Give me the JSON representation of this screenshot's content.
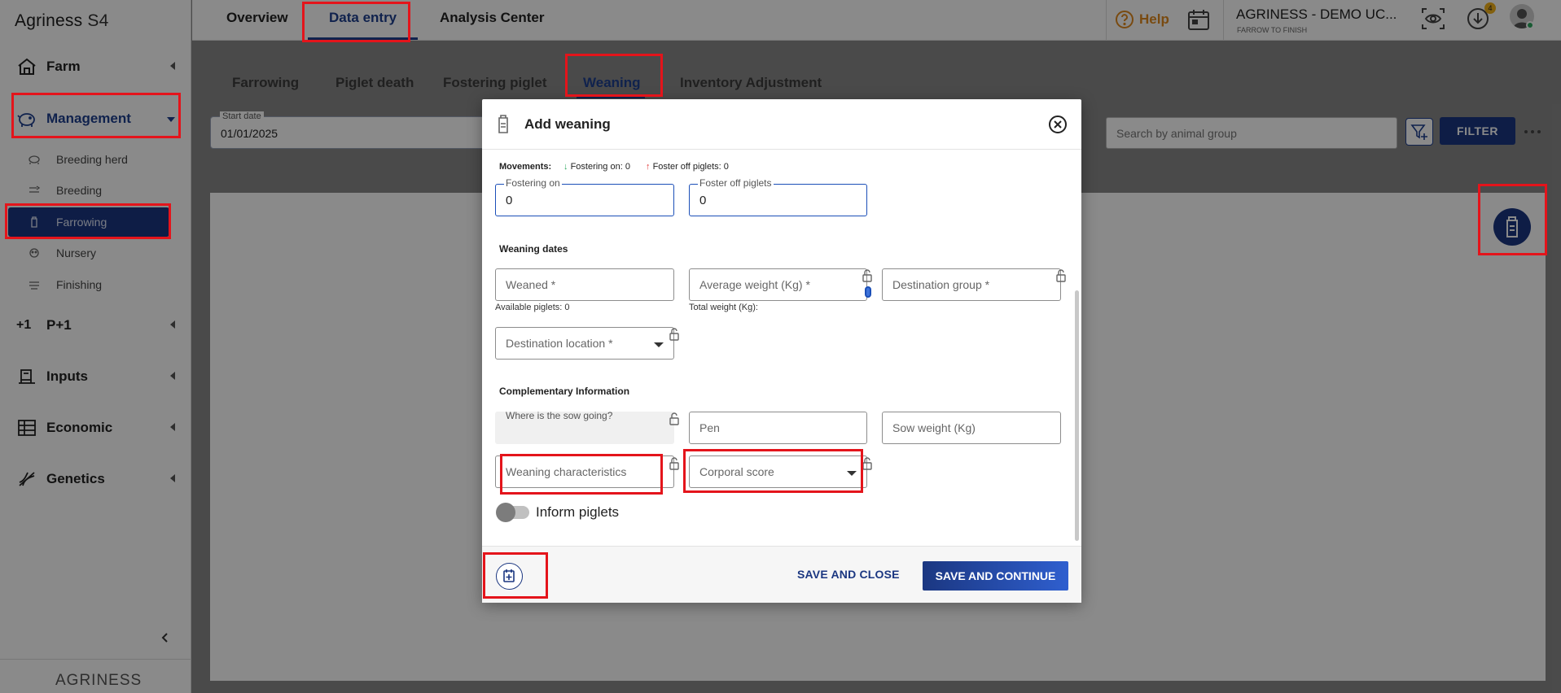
{
  "app": {
    "name": "Agriness",
    "version": "S4",
    "logo": "AGRINESS"
  },
  "sidebar": {
    "items": [
      {
        "label": "Farm",
        "icon": "farm-icon"
      },
      {
        "label": "Management",
        "icon": "management-icon",
        "expanded": true
      },
      {
        "label": "P+1",
        "icon": "p1-icon"
      },
      {
        "label": "Inputs",
        "icon": "inputs-icon"
      },
      {
        "label": "Economic",
        "icon": "economic-icon"
      },
      {
        "label": "Genetics",
        "icon": "genetics-icon"
      }
    ],
    "sub_items": [
      {
        "label": "Breeding herd",
        "icon": "breeding-herd-icon"
      },
      {
        "label": "Breeding",
        "icon": "breeding-icon"
      },
      {
        "label": "Farrowing",
        "icon": "farrowing-icon",
        "active": true
      },
      {
        "label": "Nursery",
        "icon": "nursery-icon"
      },
      {
        "label": "Finishing",
        "icon": "finishing-icon"
      }
    ]
  },
  "topbar": {
    "tabs": [
      "Overview",
      "Data entry",
      "Analysis Center"
    ],
    "active_tab": "Data entry",
    "help_label": "Help",
    "org_name": "AGRINESS - DEMO UC...",
    "org_subtitle": "FARROW TO FINISH",
    "download_badge": "4"
  },
  "subtabs": {
    "items": [
      "Farrowing",
      "Piglet death",
      "Fostering piglet",
      "Weaning",
      "Inventory Adjustment"
    ],
    "active": "Weaning"
  },
  "filters": {
    "start_date_label": "Start date",
    "start_date_value": "01/01/2025",
    "search_placeholder": "Search by animal group",
    "filter_button": "FILTER"
  },
  "modal": {
    "title": "Add weaning",
    "movements": {
      "label": "Movements:",
      "fostering_on": "Fostering on: 0",
      "foster_off": "Foster off piglets: 0"
    },
    "fostering_on": {
      "label": "Fostering on",
      "value": "0"
    },
    "foster_off": {
      "label": "Foster off piglets",
      "value": "0"
    },
    "weaning_dates_title": "Weaning dates",
    "weaned_placeholder": "Weaned *",
    "avg_weight_placeholder": "Average weight (Kg) *",
    "destination_group_placeholder": "Destination group *",
    "available_piglets": "Available piglets: 0",
    "total_weight": "Total weight (Kg):",
    "destination_location_placeholder": "Destination location *",
    "complementary_title": "Complementary Information",
    "sow_going_label": "Where is the sow going?",
    "pen_placeholder": "Pen",
    "sow_weight_placeholder": "Sow weight (Kg)",
    "weaning_characteristics_placeholder": "Weaning characteristics",
    "corporal_score_placeholder": "Corporal score",
    "inform_piglets_label": "Inform piglets",
    "inform_piglets_on": false,
    "save_close": "SAVE AND CLOSE",
    "save_continue": "SAVE AND CONTINUE"
  },
  "colors": {
    "primary": "#1b3781",
    "accent_help": "#e08a1e",
    "highlight_box": "#e4141b",
    "badge": "#f2b21b",
    "online": "#2da85f"
  }
}
